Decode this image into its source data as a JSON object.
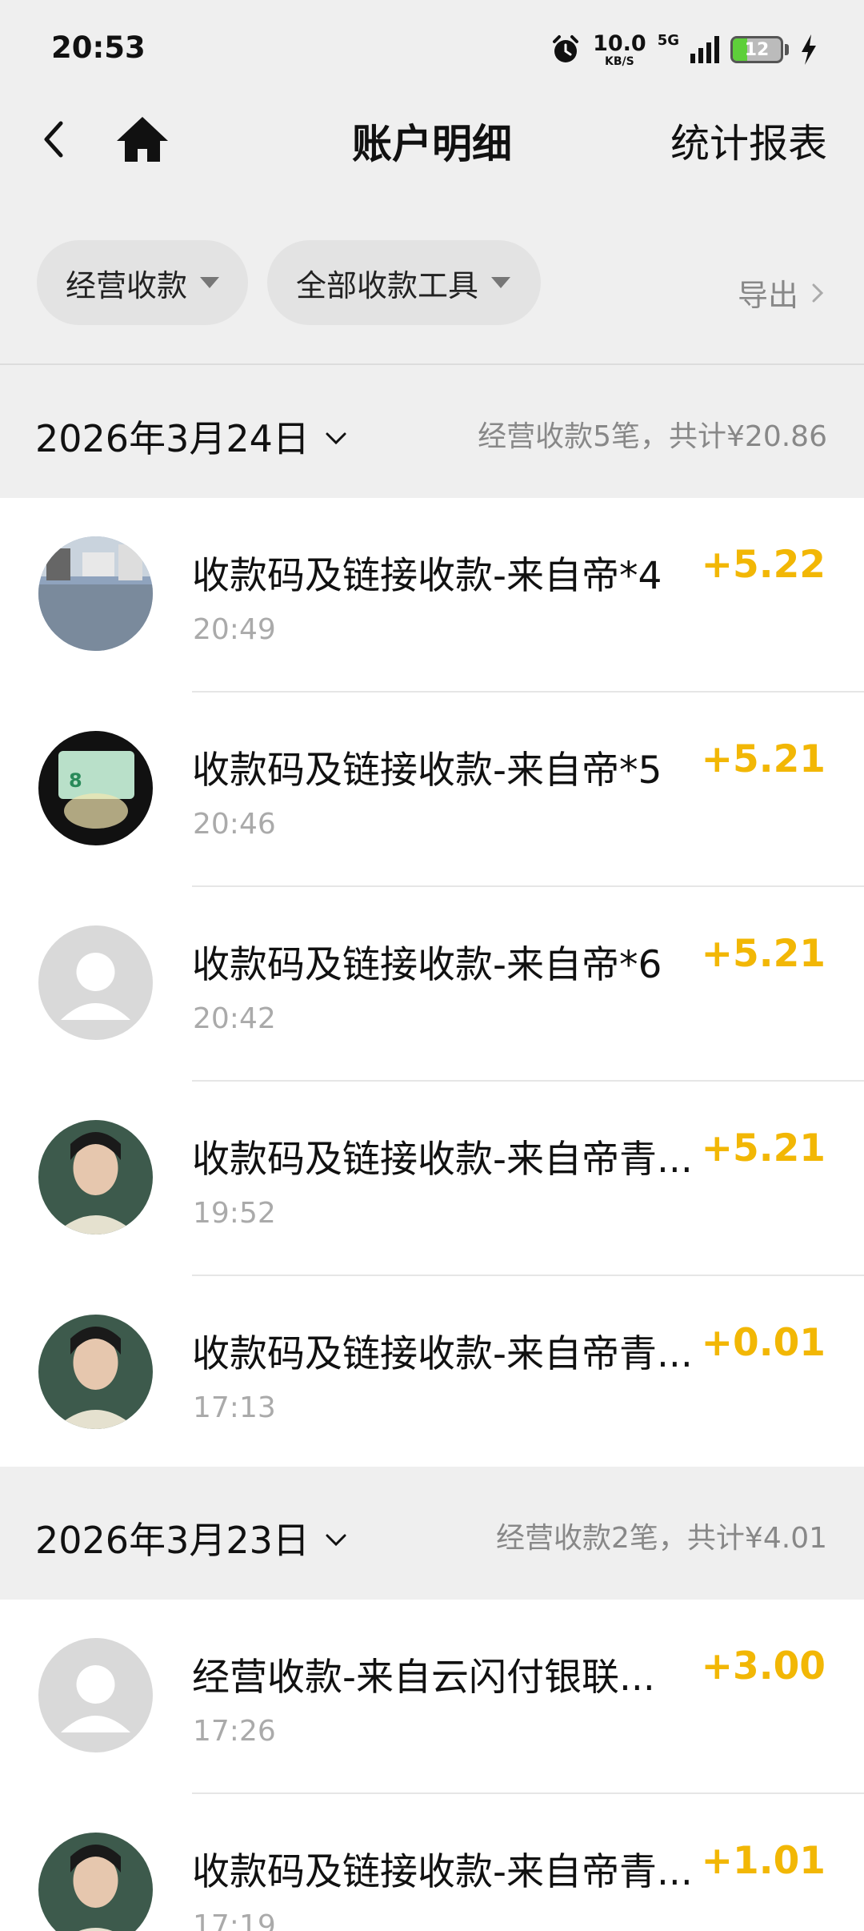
{
  "status_bar": {
    "time": "20:53",
    "net_speed": "10.0",
    "net_speed_unit": "KB/S",
    "network": "5G",
    "battery": "12"
  },
  "nav": {
    "title": "账户明细",
    "report_label": "统计报表",
    "icons": [
      "back-icon",
      "home-icon"
    ]
  },
  "filters": {
    "type_label": "经营收款",
    "tool_label": "全部收款工具",
    "export_label": "导出"
  },
  "groups": [
    {
      "date": "2026年3月24日",
      "summary": "经营收款5笔，共计¥20.86",
      "items": [
        {
          "title": "收款码及链接收款-来自帝*4",
          "time": "20:49",
          "amount": "+5.22",
          "avatar": "street-photo"
        },
        {
          "title": "收款码及链接收款-来自帝*5",
          "time": "20:46",
          "amount": "+5.21",
          "avatar": "card-photo"
        },
        {
          "title": "收款码及链接收款-来自帝*6",
          "time": "20:42",
          "amount": "+5.21",
          "avatar": "default-user"
        },
        {
          "title": "收款码及链接收款-来自帝青...",
          "time": "19:52",
          "amount": "+5.21",
          "avatar": "portrait"
        },
        {
          "title": "收款码及链接收款-来自帝青...",
          "time": "17:13",
          "amount": "+0.01",
          "avatar": "portrait"
        }
      ]
    },
    {
      "date": "2026年3月23日",
      "summary": "经营收款2笔，共计¥4.01",
      "items": [
        {
          "title": "经营收款-来自云闪付银联...",
          "time": "17:26",
          "amount": "+3.00",
          "avatar": "default-user"
        },
        {
          "title": "收款码及链接收款-来自帝青...",
          "time": "17:19",
          "amount": "+1.01",
          "avatar": "portrait"
        }
      ]
    }
  ],
  "colors": {
    "amount": "#f2b705",
    "background": "#efefef"
  }
}
